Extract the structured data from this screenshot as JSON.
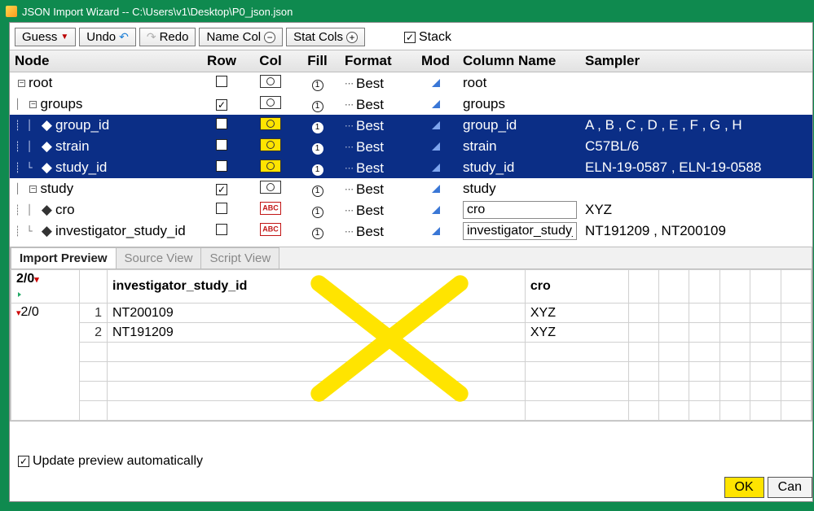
{
  "window": {
    "title": "JSON Import Wizard -- C:\\Users\\v1\\Desktop\\P0_json.json"
  },
  "toolbar": {
    "guess": "Guess",
    "undo": "Undo",
    "redo": "Redo",
    "name_col": "Name Col",
    "stat_cols": "Stat Cols",
    "stack": "Stack"
  },
  "columns": {
    "node": "Node",
    "row": "Row",
    "col": "Col",
    "fill": "Fill",
    "format": "Format",
    "mod": "Mod",
    "colname": "Column Name",
    "sampler": "Sampler"
  },
  "tree": [
    {
      "indent": 0,
      "kind": "branch",
      "label": "root",
      "row_checked": false,
      "col": "std",
      "fill": "1",
      "format": "Best",
      "colname": "root",
      "sampler": "",
      "selected": false
    },
    {
      "indent": 1,
      "kind": "branch",
      "label": "groups",
      "row_checked": true,
      "col": "std",
      "fill": "1",
      "format": "Best",
      "colname": "groups",
      "sampler": "",
      "selected": false
    },
    {
      "indent": 2,
      "kind": "leaf",
      "label": "group_id",
      "row_checked": false,
      "col": "sel",
      "fill": "1",
      "format": "Best",
      "colname": "group_id",
      "sampler": "A , B , C , D , E , F , G , H",
      "selected": true
    },
    {
      "indent": 2,
      "kind": "leaf",
      "label": "strain",
      "row_checked": false,
      "col": "sel",
      "fill": "1",
      "format": "Best",
      "colname": "strain",
      "sampler": "C57BL/6",
      "selected": true
    },
    {
      "indent": 2,
      "kind": "leaf-last",
      "label": "study_id",
      "row_checked": false,
      "col": "sel",
      "fill": "1",
      "format": "Best",
      "colname": "study_id",
      "sampler": "ELN-19-0587 , ELN-19-0588",
      "selected": true
    },
    {
      "indent": 1,
      "kind": "branch",
      "label": "study",
      "row_checked": true,
      "col": "std",
      "fill": "1",
      "format": "Best",
      "colname": "study",
      "sampler": "",
      "selected": false
    },
    {
      "indent": 2,
      "kind": "leaf",
      "label": "cro",
      "row_checked": false,
      "col": "abc",
      "fill": "1",
      "format": "Best",
      "colname": "cro",
      "colname_editable": true,
      "sampler": "XYZ",
      "selected": false
    },
    {
      "indent": 2,
      "kind": "leaf-last",
      "label": "investigator_study_id",
      "row_checked": false,
      "col": "abc",
      "fill": "1",
      "format": "Best",
      "colname": "investigator_study_id",
      "colname_editable": true,
      "sampler": "NT191209 , NT200109",
      "selected": false
    }
  ],
  "tabs": {
    "import": "Import Preview",
    "source": "Source View",
    "script": "Script View"
  },
  "preview": {
    "corner_top": "2/0",
    "corner_side": "2/0",
    "headers": [
      "investigator_study_id",
      "cro"
    ],
    "rows": [
      {
        "n": "1",
        "cells": [
          "NT200109",
          "XYZ"
        ]
      },
      {
        "n": "2",
        "cells": [
          "NT191209",
          "XYZ"
        ]
      }
    ]
  },
  "footer": {
    "update": "Update preview automatically"
  },
  "buttons": {
    "ok": "OK",
    "cancel": "Can"
  }
}
